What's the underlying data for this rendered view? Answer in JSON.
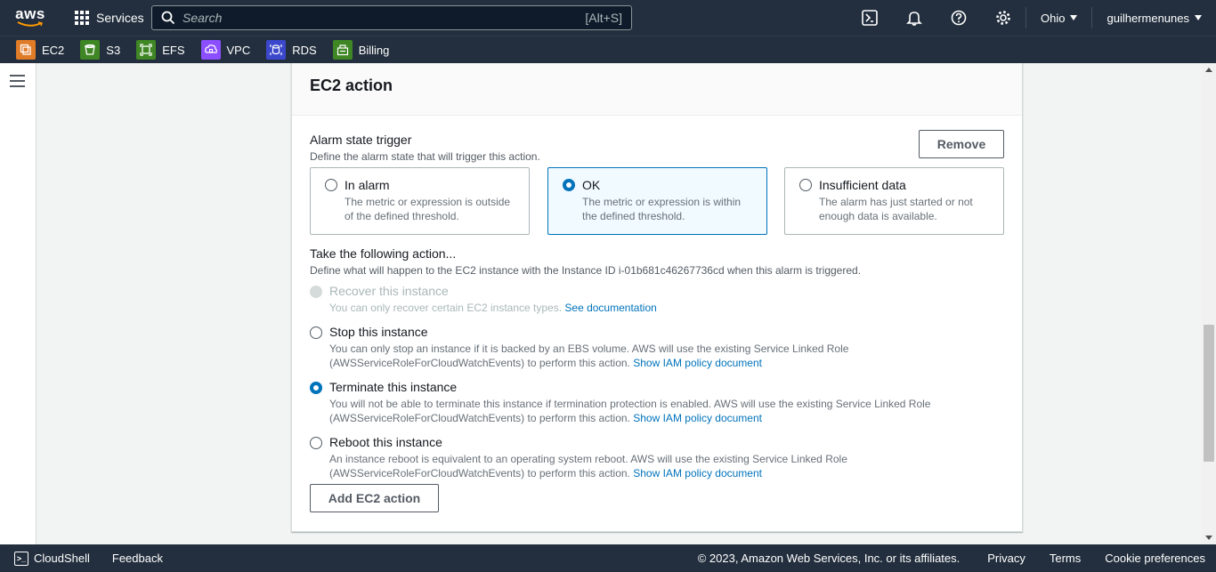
{
  "topnav": {
    "logo_text": "aws",
    "services_label": "Services",
    "search_placeholder": "Search",
    "search_shortcut": "[Alt+S]",
    "region": "Ohio",
    "username": "guilhermenunes"
  },
  "favorites": [
    {
      "label": "EC2",
      "icon": "ec2-icon",
      "color": "#e07b28"
    },
    {
      "label": "S3",
      "icon": "s3-icon",
      "color": "#3f8624"
    },
    {
      "label": "EFS",
      "icon": "efs-icon",
      "color": "#3f8624"
    },
    {
      "label": "VPC",
      "icon": "vpc-icon",
      "color": "#8c4fff"
    },
    {
      "label": "RDS",
      "icon": "rds-icon",
      "color": "#3b48cc"
    },
    {
      "label": "Billing",
      "icon": "billing-icon",
      "color": "#3f8624"
    }
  ],
  "panel": {
    "title": "EC2 action",
    "alarm_trigger_label": "Alarm state trigger",
    "alarm_trigger_desc": "Define the alarm state that will trigger this action.",
    "remove_label": "Remove",
    "states": [
      {
        "title": "In alarm",
        "desc": "The metric or expression is outside of the defined threshold.",
        "selected": false
      },
      {
        "title": "OK",
        "desc": "The metric or expression is within the defined threshold.",
        "selected": true
      },
      {
        "title": "Insufficient data",
        "desc": "The alarm has just started or not enough data is available.",
        "selected": false
      }
    ],
    "action_label": "Take the following action...",
    "action_desc": "Define what will happen to the EC2 instance with the Instance ID i-01b681c46267736cd when this alarm is triggered.",
    "actions": [
      {
        "title": "Recover this instance",
        "desc": "You can only recover certain EC2 instance types.",
        "link": "See documentation",
        "disabled": true,
        "selected": false
      },
      {
        "title": "Stop this instance",
        "desc": "You can only stop an instance if it is backed by an EBS volume. AWS will use the existing Service Linked Role (AWSServiceRoleForCloudWatchEvents) to perform this action.",
        "link": "Show IAM policy document",
        "disabled": false,
        "selected": false
      },
      {
        "title": "Terminate this instance",
        "desc": "You will not be able to terminate this instance if termination protection is enabled. AWS will use the existing Service Linked Role (AWSServiceRoleForCloudWatchEvents) to perform this action.",
        "link": "Show IAM policy document",
        "disabled": false,
        "selected": true
      },
      {
        "title": "Reboot this instance",
        "desc": "An instance reboot is equivalent to an operating system reboot. AWS will use the existing Service Linked Role (AWSServiceRoleForCloudWatchEvents) to perform this action.",
        "link": "Show IAM policy document",
        "disabled": false,
        "selected": false
      }
    ],
    "add_action_label": "Add EC2 action"
  },
  "footer": {
    "cloudshell": "CloudShell",
    "feedback": "Feedback",
    "copyright": "© 2023, Amazon Web Services, Inc. or its affiliates.",
    "privacy": "Privacy",
    "terms": "Terms",
    "cookies": "Cookie preferences"
  },
  "colors": {
    "nav_bg": "#232f3e",
    "accent": "#0073bb",
    "selected_tile_bg": "#f1faff"
  }
}
